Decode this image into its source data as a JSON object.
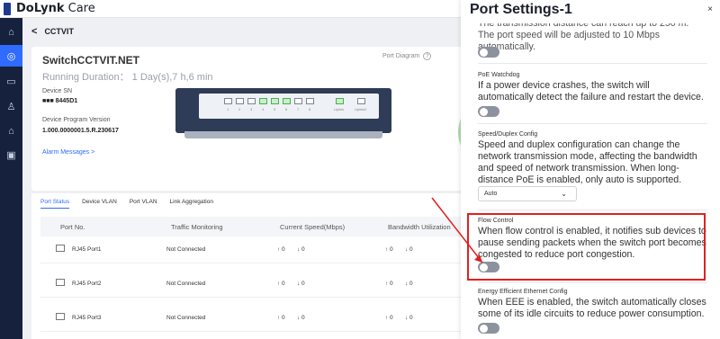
{
  "app": {
    "brand_bold": "DoLynk",
    "brand_rest": " Care"
  },
  "nav": [
    "home-icon",
    "location-icon",
    "message-icon",
    "user-icon",
    "building-icon",
    "calendar-icon"
  ],
  "breadcrumb": {
    "title": "CCTVIT"
  },
  "device": {
    "name": "SwitchCCTVIT.NET",
    "running": "Running Duration： 1 Day(s),7 h,6 min",
    "sn_label": "Device SN",
    "sn_value": "■■■ 8445D1",
    "version_label": "Device Program Version",
    "version_value": "1.000.0000001.5.R.230617",
    "alarm": "Alarm Messages >",
    "port_diagram": "Port Diagram",
    "right_peek": "R"
  },
  "switch_ports": [
    "1",
    "2",
    "3",
    "4",
    "5",
    "6",
    "7",
    "8"
  ],
  "uplink_labels": [
    "Uplink",
    "Uplink2"
  ],
  "tabs": [
    "Port Status",
    "Device VLAN",
    "Port VLAN",
    "Link Aggregation"
  ],
  "table": {
    "headers": [
      "Port No.",
      "Traffic Monitoring",
      "Current Speed(Mbps)",
      "Bandwidth Utilization"
    ],
    "rows": [
      {
        "port": "RJ45 Port1",
        "traffic": "Not Connected",
        "s1": "↑ 0",
        "s2": "↓ 0",
        "b1": "↑ 0",
        "b2": "↓ 0"
      },
      {
        "port": "RJ45 Port2",
        "traffic": "Not Connected",
        "s1": "↑ 0",
        "s2": "↓ 0",
        "b1": "↑ 0",
        "b2": "↓ 0"
      },
      {
        "port": "RJ45 Port3",
        "traffic": "Not Connected",
        "s1": "↑ 0",
        "s2": "↓ 0",
        "b1": "↑ 0",
        "b2": "↓ 0"
      }
    ]
  },
  "drawer": {
    "title": "Port Settings-1",
    "close": "×",
    "top_text": "The transmission distance can reach up to 250 m. The port speed will be adjusted to 10 Mbps automatically.",
    "poe_label": "PoE Watchdog",
    "poe_text": "If a power device crashes, the switch will automatically detect the failure and restart the device.",
    "speed_label": "Speed/Duplex Config",
    "speed_text": "Speed and duplex configuration can change the network transmission mode, affecting the bandwidth and speed of network transmission. When long-distance PoE is enabled, only auto is supported.",
    "speed_value": "Auto",
    "flow_label": "Flow Control",
    "flow_text": "When flow control is enabled, it notifies sub devices to pause sending packets when the switch port becomes congested to reduce port congestion.",
    "eee_label": "Energy Efficient Ethernet Config",
    "eee_text": "When EEE is enabled, the switch automatically closes some of its idle circuits to reduce power consumption."
  },
  "colors": {
    "highlight": "#e02020",
    "accent": "#2f6bff",
    "nav_bg": "#16213e"
  }
}
